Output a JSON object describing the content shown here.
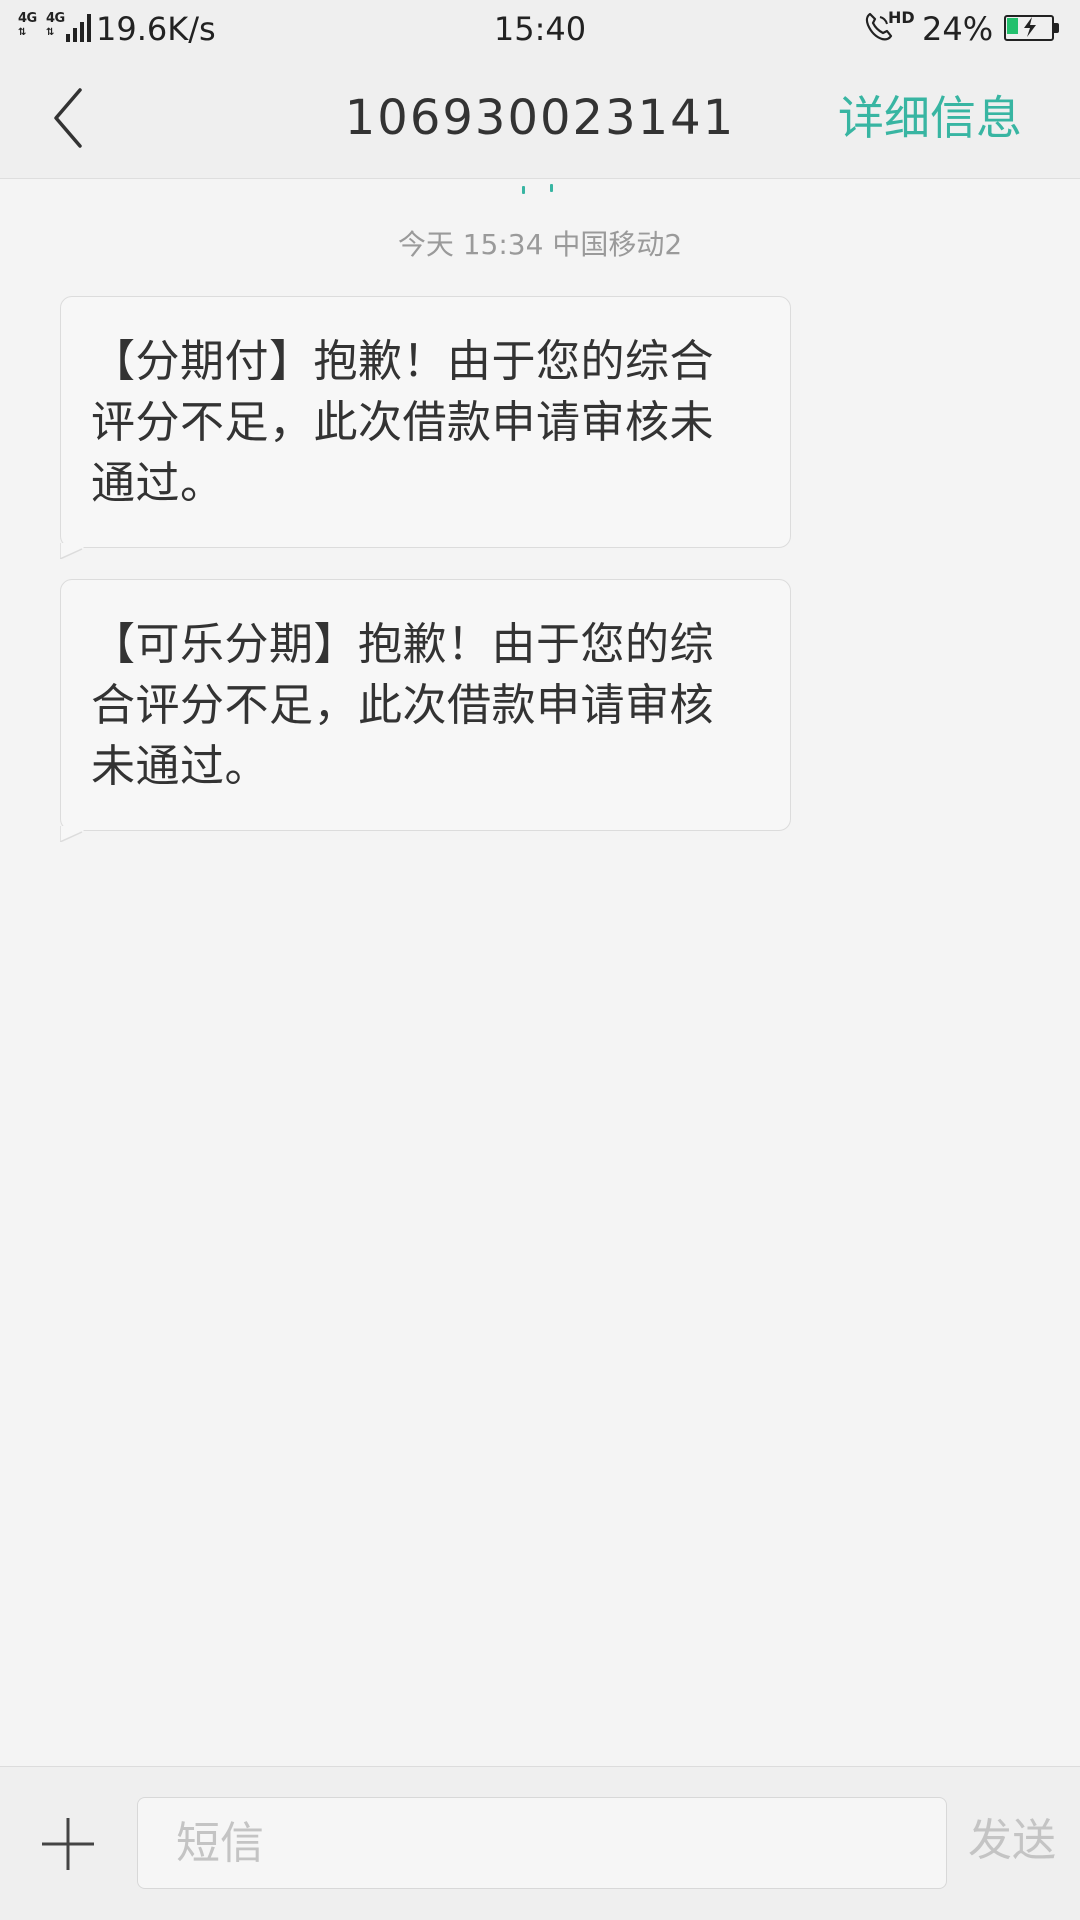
{
  "status_bar": {
    "network_type_1": "4G",
    "network_type_2": "4G",
    "network_speed": "19.6K/s",
    "time": "15:40",
    "hd_label": "HD",
    "battery_percent_text": "24%",
    "battery_level": 0.24,
    "battery_color": "#23c06d",
    "icons": [
      "signal-icon",
      "hd-call-icon",
      "battery-charging-icon"
    ]
  },
  "header": {
    "title": "106930023141",
    "detail_label": "详细信息",
    "accent_color": "#38b5a2",
    "back_icon": "chevron-left-icon"
  },
  "conversation": {
    "timestamp": "今天  15:34  中国移动2",
    "messages": [
      {
        "text": "【分期付】抱歉！由于您的综合评分不足，此次借款申请审核未通过。"
      },
      {
        "text": "【可乐分期】抱歉！由于您的综合评分不足，此次借款申请审核未通过。"
      }
    ]
  },
  "composer": {
    "add_icon": "plus-icon",
    "placeholder": "短信",
    "value": "",
    "send_label": "发送"
  }
}
